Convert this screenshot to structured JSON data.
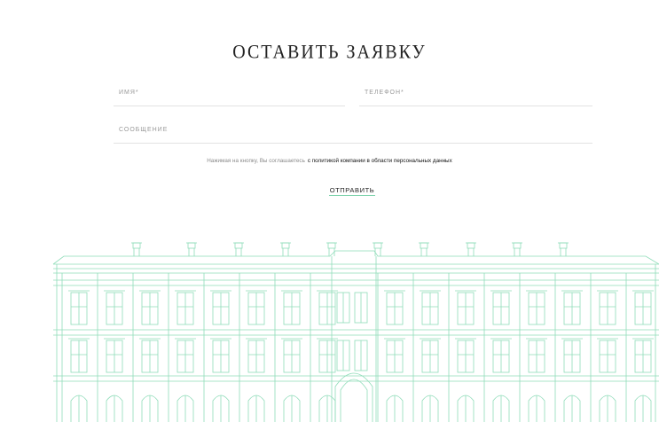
{
  "form": {
    "title": "Оставить заявку",
    "name_placeholder": "имя*",
    "phone_placeholder": "телефон*",
    "message_placeholder": "сообщение",
    "consent_text": "Нажимая на кнопку, Вы соглашаетесь",
    "consent_link": "с политикой компании в области персональных данных",
    "submit_label": "отправить"
  },
  "colors": {
    "accent": "#7fd3ad",
    "text": "#222222",
    "muted": "#8a8a8a",
    "building_line": "#8fdcb9"
  }
}
